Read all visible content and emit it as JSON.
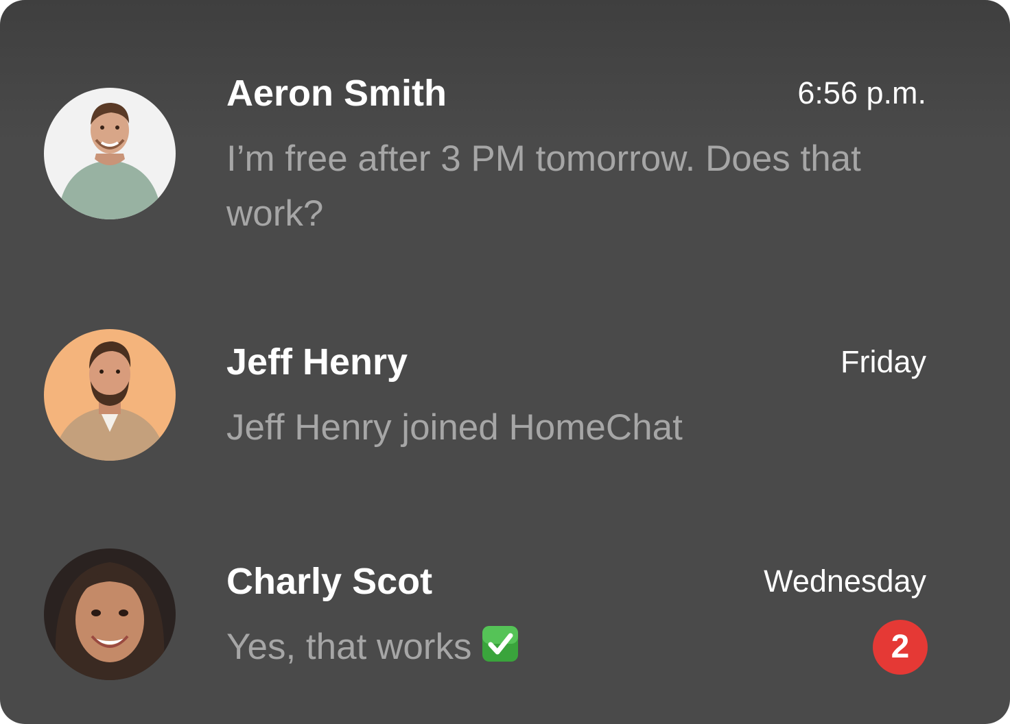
{
  "conversations": [
    {
      "name": "Aeron Smith",
      "time": "6:56 p.m.",
      "message": "I’m free after 3 PM tomorrow. Does that work?",
      "avatar_icon": "avatar-photo-aeron-smith",
      "avatar_bg": "#f2f2f2"
    },
    {
      "name": "Jeff Henry",
      "time": "Friday",
      "message": "Jeff Henry joined HomeChat",
      "avatar_icon": "avatar-photo-jeff-henry",
      "avatar_bg": "#f4b47c"
    },
    {
      "name": "Charly Scot",
      "time": "Wednesday",
      "message": "Yes, that works",
      "message_emoji": "check-mark-button-icon",
      "unread_count": "2",
      "avatar_icon": "avatar-photo-charly-scot",
      "avatar_bg": "#2a2220"
    }
  ],
  "colors": {
    "panel_background": "#4a4a4a",
    "name_text": "#ffffff",
    "message_text": "#a6a6a6",
    "badge": "#e53935"
  }
}
